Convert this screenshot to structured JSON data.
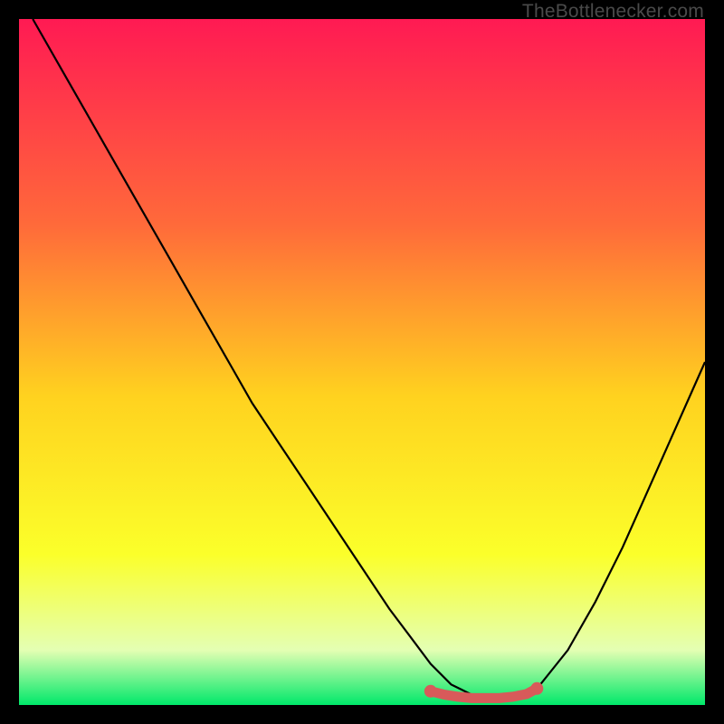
{
  "watermark": "TheBottlenecker.com",
  "colors": {
    "gradient_top": "#ff1a53",
    "gradient_mid1": "#ff6a3a",
    "gradient_mid2": "#ffd21f",
    "gradient_mid3": "#fbff2a",
    "gradient_mid4": "#e4ffb3",
    "gradient_bottom": "#00e86a",
    "curve": "#000000",
    "marker": "#d85a5a",
    "frame_bg": "#000000"
  },
  "chart_data": {
    "type": "line",
    "title": "",
    "xlabel": "",
    "ylabel": "",
    "xlim": [
      0,
      100
    ],
    "ylim": [
      0,
      100
    ],
    "series": [
      {
        "name": "bottleneck-curve",
        "x": [
          2,
          6,
          10,
          14,
          18,
          22,
          26,
          30,
          34,
          38,
          42,
          46,
          50,
          54,
          57,
          60,
          63,
          66,
          68,
          70,
          73,
          76,
          80,
          84,
          88,
          92,
          96,
          100
        ],
        "y": [
          100,
          93,
          86,
          79,
          72,
          65,
          58,
          51,
          44,
          38,
          32,
          26,
          20,
          14,
          10,
          6,
          3,
          1.5,
          1,
          1,
          1.5,
          3,
          8,
          15,
          23,
          32,
          41,
          50
        ]
      }
    ],
    "markers": {
      "name": "optimal-region",
      "x": [
        60,
        62,
        64,
        66,
        68,
        70,
        72,
        74,
        75.5
      ],
      "y": [
        2.0,
        1.5,
        1.2,
        1.0,
        1.0,
        1.0,
        1.2,
        1.6,
        2.4
      ]
    }
  }
}
